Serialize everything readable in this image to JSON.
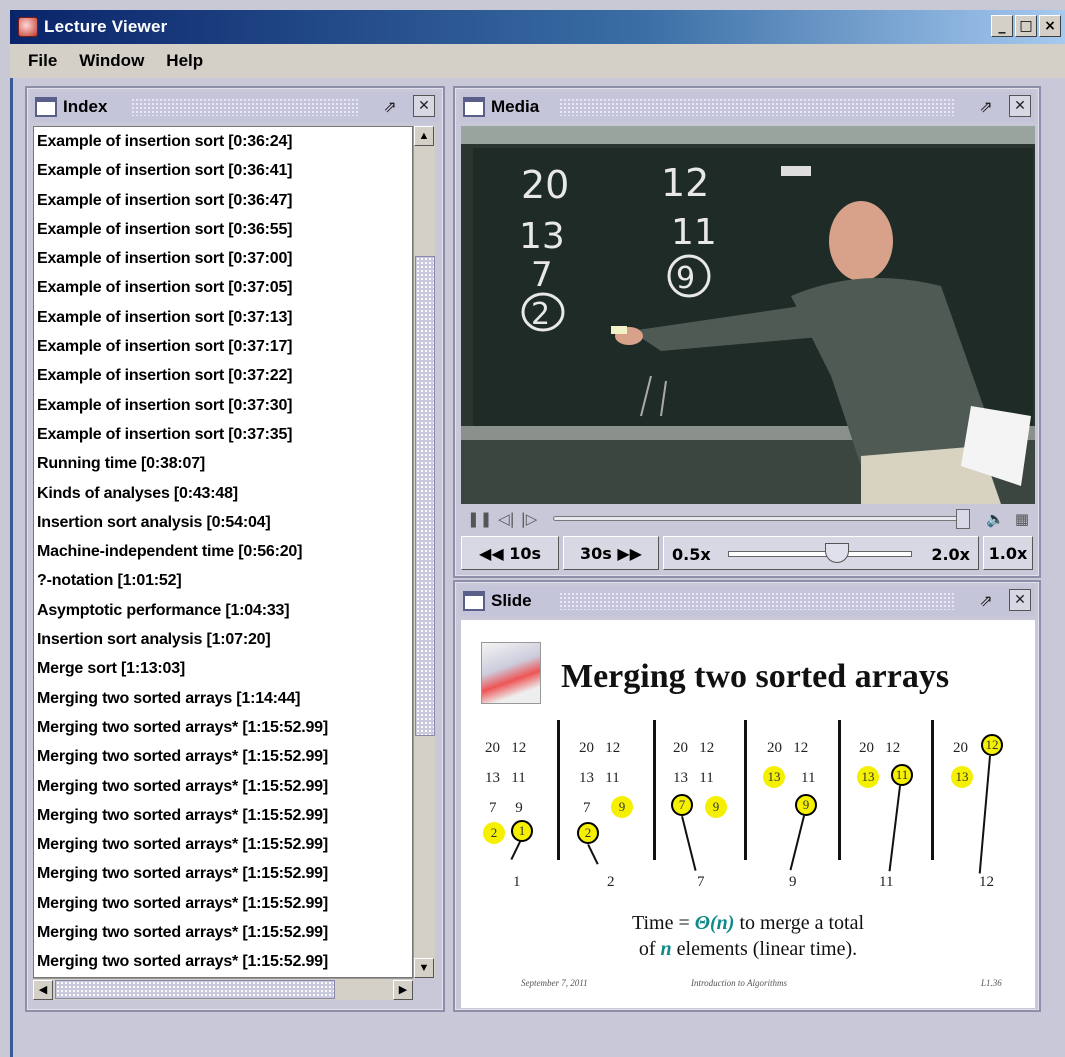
{
  "window": {
    "title": "Lecture Viewer",
    "minimize": "_",
    "maximize": "□",
    "close": "×"
  },
  "menu": {
    "file": "File",
    "window": "Window",
    "help": "Help"
  },
  "index_panel": {
    "title": "Index",
    "items": [
      "Example of insertion sort   [0:36:24]",
      "Example of insertion sort   [0:36:41]",
      "Example of insertion sort   [0:36:47]",
      "Example of insertion sort   [0:36:55]",
      "Example of insertion sort   [0:37:00]",
      "Example of insertion sort   [0:37:05]",
      "Example of insertion sort   [0:37:13]",
      "Example of insertion sort   [0:37:17]",
      "Example of insertion sort   [0:37:22]",
      "Example of insertion sort   [0:37:30]",
      "Example of insertion sort   [0:37:35]",
      "Running time   [0:38:07]",
      "Kinds of analyses   [0:43:48]",
      "Insertion sort analysis   [0:54:04]",
      "Machine-independent time   [0:56:20]",
      "?-notation   [1:01:52]",
      "Asymptotic performance   [1:04:33]",
      "Insertion sort analysis   [1:07:20]",
      "Merge sort   [1:13:03]",
      "Merging two sorted arrays   [1:14:44]",
      "Merging two sorted arrays*   [1:15:52.99]",
      "Merging two sorted arrays*   [1:15:52.99]",
      "Merging two sorted arrays*   [1:15:52.99]",
      "Merging two sorted arrays*   [1:15:52.99]",
      "Merging two sorted arrays*   [1:15:52.99]",
      "Merging two sorted arrays*   [1:15:52.99]",
      "Merging two sorted arrays*   [1:15:52.99]",
      "Merging two sorted arrays*   [1:15:52.99]",
      "Merging two sorted arrays*   [1:15:52.99]",
      "Merging two sorted arrays*   [1:15:52.99]"
    ]
  },
  "media_panel": {
    "title": "Media",
    "back_label": "◀◀ 10s",
    "fwd_label": "30s ▶▶",
    "speed_min": "0.5x",
    "speed_max": "2.0x",
    "speed_current": "1.0x",
    "board": {
      "col1": [
        "20",
        "13",
        "7",
        "2"
      ],
      "col2": [
        "12",
        "11",
        "9"
      ]
    }
  },
  "slide_panel": {
    "title": "Slide",
    "heading": "Merging two sorted arrays",
    "results": [
      "1",
      "2",
      "7",
      "9",
      "11",
      "12"
    ],
    "caption_line1_pre": "Time = ",
    "caption_theta": "Θ(n)",
    "caption_line1_post": " to merge a total",
    "caption_line2_pre": "of ",
    "caption_n": "n",
    "caption_line2_post": " elements (linear time).",
    "footer_left": "September 7, 2011",
    "footer_center": "Introduction to Algorithms",
    "footer_right": "L1.36"
  },
  "colors": {
    "titlebar": "#0a246a",
    "highlight": "#f5f000",
    "teal": "#0f8a8a"
  }
}
